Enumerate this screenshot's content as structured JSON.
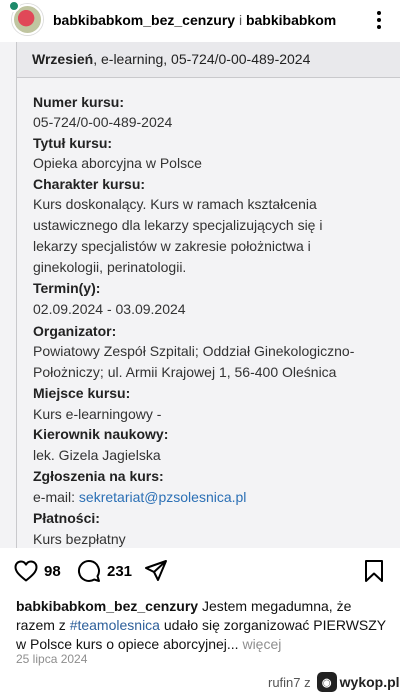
{
  "post": {
    "author": "babkibabkom_bez_cenzury",
    "separator": "i",
    "coauthor": "babkibabkom"
  },
  "document": {
    "header_bold": "Wrzesień",
    "header_rest": ", e-learning, 05-724/0-00-489-2024",
    "fields": [
      {
        "label": "Numer kursu:",
        "lines": [
          "05-724/0-00-489-2024"
        ]
      },
      {
        "label": "Tytuł kursu:",
        "lines": [
          "Opieka aborcyjna w Polsce"
        ]
      },
      {
        "label": "Charakter kursu:",
        "lines": [
          "Kurs doskonalący. Kurs w ramach kształcenia",
          "ustawicznego dla lekarzy specjalizujących się i",
          "lekarzy specjalistów w zakresie położnictwa i",
          "ginekologii, perinatologii."
        ]
      },
      {
        "label": "Termin(y):",
        "lines": [
          "02.09.2024 - 03.09.2024"
        ]
      },
      {
        "label": "Organizator:",
        "lines": [
          "Powiatowy Zespół Szpitali; Oddział Ginekologiczno-",
          "Położniczy; ul. Armii Krajowej 1, 56-400 Oleśnica"
        ]
      },
      {
        "label": "Miejsce kursu:",
        "lines": [
          "Kurs e-learningowy -"
        ]
      },
      {
        "label": "Kierownik naukowy:",
        "lines": [
          "lek. Gizela Jagielska"
        ]
      },
      {
        "label": "Zgłoszenia na kurs:",
        "lines": [
          "e-mail: "
        ],
        "link": "sekretariat@pzsolesnica.pl"
      },
      {
        "label": "Płatności:",
        "lines": [
          "Kurs bezpłatny"
        ]
      }
    ]
  },
  "actions": {
    "likes": "98",
    "comments": "231",
    "like_icon": "heart-icon",
    "comment_icon": "comment-icon",
    "share_icon": "send-icon",
    "save_icon": "bookmark-icon"
  },
  "caption": {
    "user": "babkibabkom_bez_cenzury",
    "text_1": " Jestem megadumna, że razem z ",
    "hashtag": "#teamolesnica",
    "text_2": " udało się zorganizować PIERWSZY w Polsce kurs o opiece aborcyjnej...",
    "more": " więcej"
  },
  "date": "25 lipca 2024",
  "watermark": {
    "user_text": "rufin7",
    "z": "z",
    "site": "wykop.pl"
  }
}
